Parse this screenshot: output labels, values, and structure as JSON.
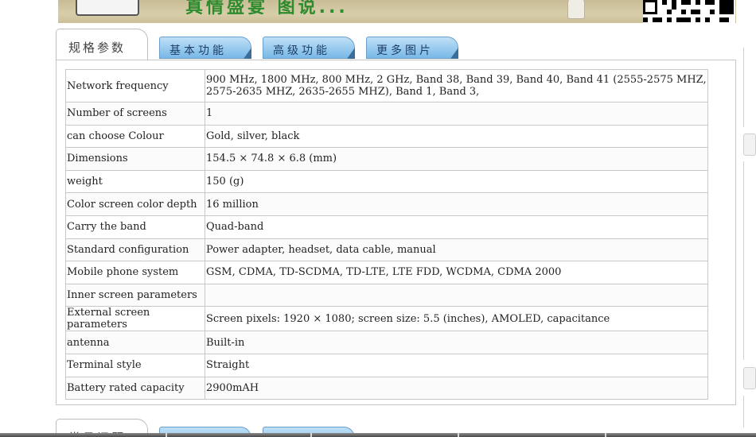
{
  "banner": {
    "slogan": "真情盛宴 图说...",
    "colors": {
      "background": "#d2c8a2",
      "slogan": "#2e8b2e"
    }
  },
  "tabs": [
    {
      "label": "规格参数",
      "active": true
    },
    {
      "label": "基本功能",
      "active": false
    },
    {
      "label": "高级功能",
      "active": false
    },
    {
      "label": "更多图片",
      "active": false
    }
  ],
  "specs": {
    "rows": [
      {
        "label": "Network frequency",
        "value": "900 MHz, 1800 MHz, 800 MHz, 2 GHz, Band 38, Band 39, Band 40, Band 41 (2555-2575 MHZ, 2575-2635 MHZ, 2635-2655 MHZ), Band 1, Band 3,"
      },
      {
        "label": "Number of screens",
        "value": "1"
      },
      {
        "label": "can choose Colour",
        "value": "Gold, silver, black"
      },
      {
        "label": "Dimensions",
        "value": "154.5 × 74.8 × 6.8 (mm)"
      },
      {
        "label": "weight",
        "value": "150 (g)"
      },
      {
        "label": "Color screen color depth",
        "value": "16 million"
      },
      {
        "label": "Carry the band",
        "value": "Quad-band"
      },
      {
        "label": "Standard configuration",
        "value": "Power adapter, headset, data cable, manual"
      },
      {
        "label": "Mobile phone system",
        "value": "GSM, CDMA, TD-SCDMA, TD-LTE, LTE FDD, WCDMA, CDMA 2000"
      },
      {
        "label": "Inner screen parameters",
        "value": ""
      },
      {
        "label": "External screen parameters",
        "value": "Screen pixels: 1920 × 1080; screen size: 5.5 (inches), AMOLED, capacitance"
      },
      {
        "label": "antenna",
        "value": "Built-in"
      },
      {
        "label": "Terminal style",
        "value": "Straight"
      },
      {
        "label": "Battery rated capacity",
        "value": "2900mAH"
      }
    ]
  },
  "bottom_tabs": [
    {
      "label": "常见问题",
      "active": true
    }
  ],
  "colors": {
    "tab_gradient_top": "#bfe0f6",
    "tab_gradient_bottom": "#78b8e8",
    "border": "#c8c8c8"
  }
}
